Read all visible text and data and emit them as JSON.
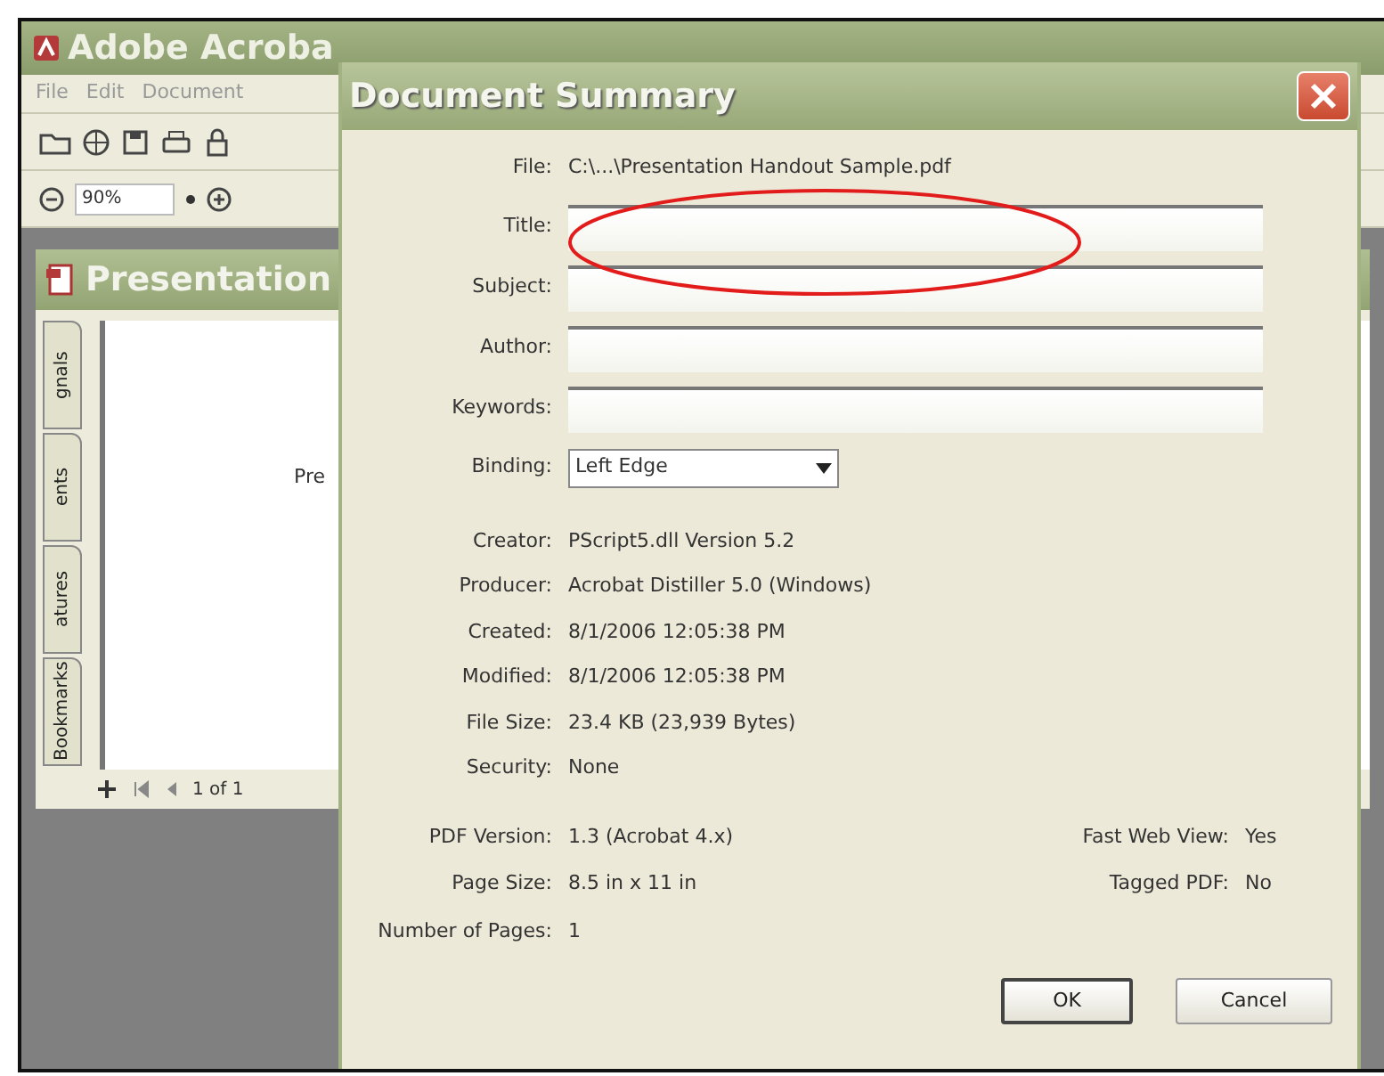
{
  "app_window": {
    "title": "Adobe Acroba",
    "menu": [
      "File",
      "Edit",
      "Document"
    ],
    "zoom": "90%",
    "document_title": "Presentation",
    "side_tabs": [
      "Bookmarks",
      "atures",
      "ents",
      "gnals"
    ],
    "page_text": "Pre",
    "page_counter": "1 of 1"
  },
  "dialog": {
    "title": "Document Summary",
    "file": {
      "label": "File:",
      "value": "C:\\...\\Presentation Handout Sample.pdf"
    },
    "fields": [
      {
        "label": "Title:",
        "circled": true
      },
      {
        "label": "Subject:",
        "circled": false
      },
      {
        "label": "Author:",
        "circled": false
      },
      {
        "label": "Keywords:",
        "circled": false
      }
    ],
    "binding": {
      "label": "Binding:",
      "value": "Left Edge"
    },
    "info": [
      {
        "label": "Creator:",
        "value": "PScript5.dll Version 5.2"
      },
      {
        "label": "Producer:",
        "value": "Acrobat Distiller 5.0 (Windows)"
      },
      {
        "label": "Created:",
        "value": "8/1/2006 12:05:38 PM"
      },
      {
        "label": "Modified:",
        "value": "8/1/2006 12:05:38 PM"
      },
      {
        "label": "File Size:",
        "value": "23.4 KB (23,939 Bytes)"
      },
      {
        "label": "Security:",
        "value": "None"
      }
    ],
    "details_left": [
      {
        "label": "PDF Version:",
        "value": "1.3 (Acrobat 4.x)"
      },
      {
        "label": "Page Size:",
        "value": "8.5 in x 11 in"
      },
      {
        "label": "Number of Pages:",
        "value": "1"
      }
    ],
    "details_right": [
      {
        "label": "Fast Web View:",
        "value": "Yes"
      },
      {
        "label": "Tagged PDF:",
        "value": "No"
      }
    ],
    "buttons": [
      {
        "label": "OK",
        "default": true
      },
      {
        "label": "Cancel",
        "default": false
      }
    ]
  }
}
